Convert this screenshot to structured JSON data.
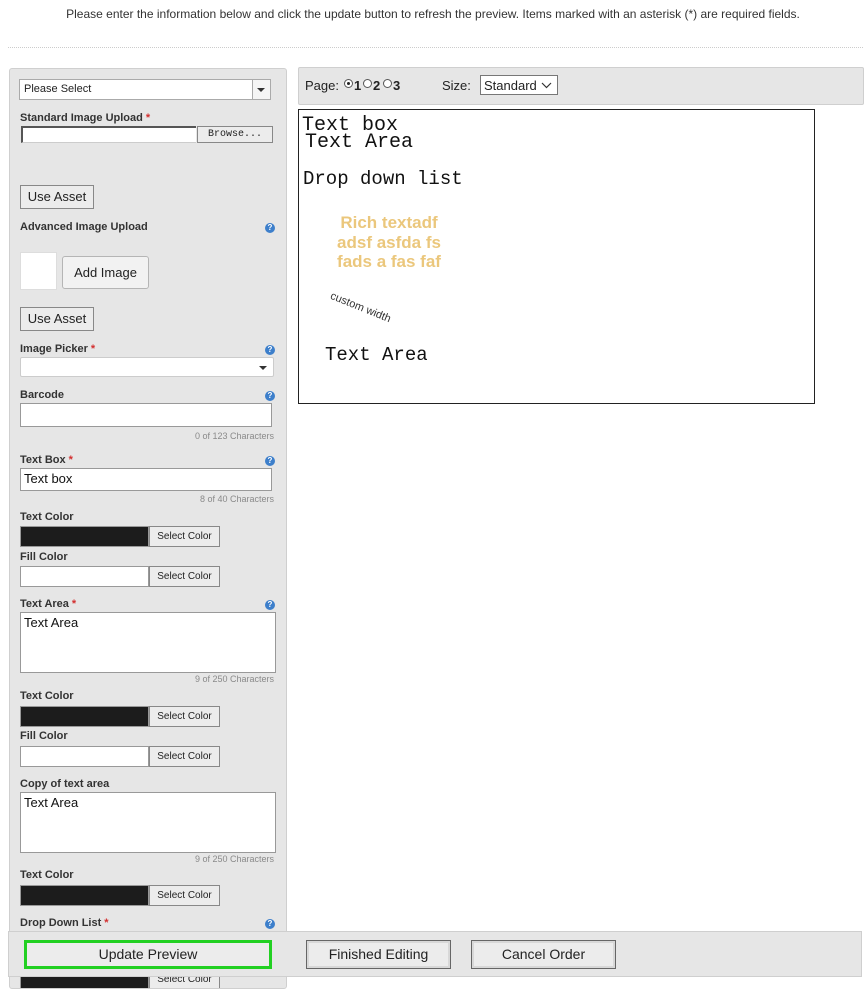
{
  "instructions": "Please enter the information below and click the update button to refresh the preview. Items marked with an asterisk (*) are required fields.",
  "form": {
    "top_select_value": "Please Select",
    "standard_image_upload_label": "Standard Image Upload",
    "browse_label": "Browse...",
    "use_asset_label": "Use Asset",
    "advanced_image_upload_label": "Advanced Image Upload",
    "add_image_label": "Add Image",
    "use_asset_label_2": "Use Asset",
    "image_picker_label": "Image Picker",
    "barcode_label": "Barcode",
    "barcode_value": "",
    "barcode_count": "0 of 123 Characters",
    "text_box_label": "Text Box",
    "text_box_value": "Text box",
    "text_box_count": "8 of 40 Characters",
    "text_color_label": "Text Color",
    "fill_color_label": "Fill Color",
    "select_color_label": "Select Color",
    "text_area_label": "Text Area",
    "text_area_value": "Text Area",
    "text_area_count": "9 of 250 Characters",
    "text_color_label_2": "Text Color",
    "fill_color_label_2": "Fill Color",
    "copy_text_area_label": "Copy of text area",
    "copy_text_area_value": "Text Area",
    "copy_text_area_count": "9 of 250 Characters",
    "text_color_label_3": "Text Color",
    "drop_down_list_label": "Drop Down List",
    "required_mark": "*",
    "help_glyph": "?",
    "colors": {
      "text_color": "#1c1c1c",
      "fill_color": "#ffffff"
    }
  },
  "preview": {
    "page_label": "Page:",
    "pages": [
      "1",
      "2",
      "3"
    ],
    "selected_page": "1",
    "size_label": "Size:",
    "size_value": "Standard",
    "canvas": {
      "text_box": "Text box",
      "text_area": "Text Area",
      "drop_down": "Drop down list",
      "rich_text_lines": [
        "Rich textadf",
        "adsf asfda fs",
        "fads a fas faf"
      ],
      "custom_width": "custom width",
      "text_area_2": "Text Area"
    }
  },
  "footer": {
    "update_preview": "Update Preview",
    "finished_editing": "Finished Editing",
    "cancel_order": "Cancel Order"
  }
}
